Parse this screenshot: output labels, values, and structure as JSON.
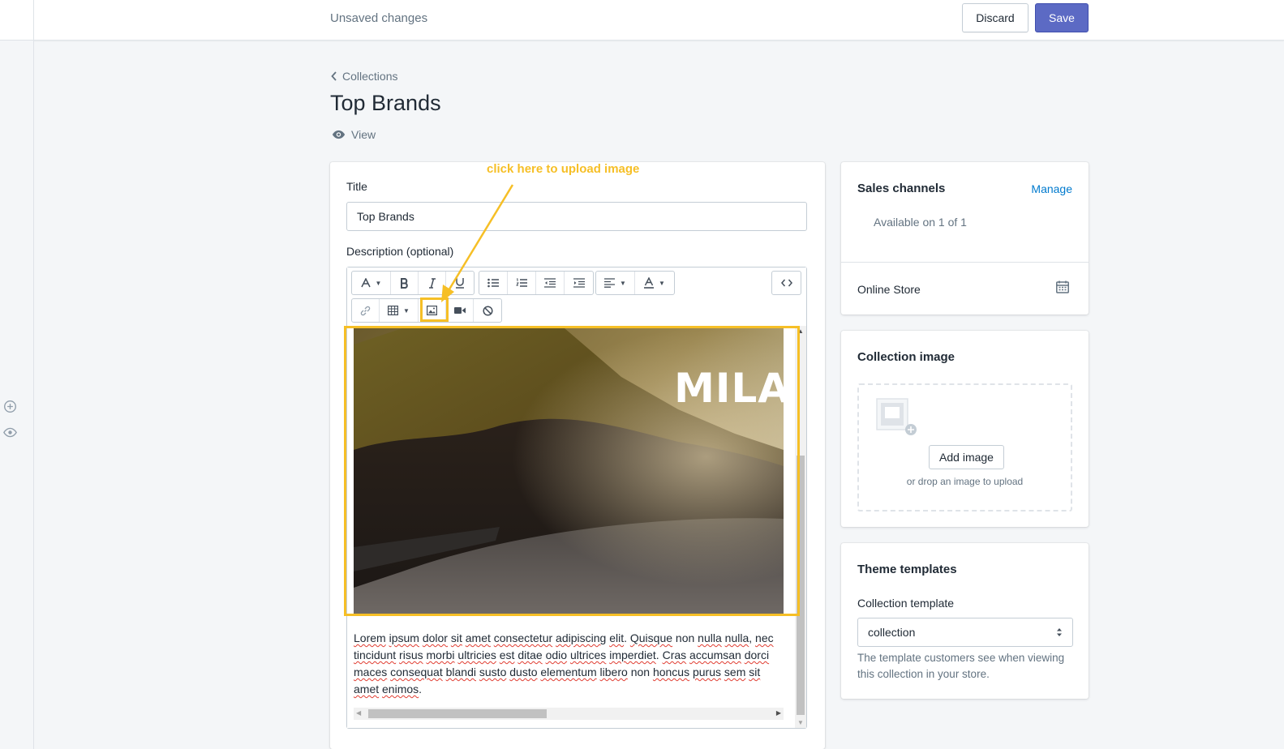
{
  "topbar": {
    "status": "Unsaved changes",
    "discard_label": "Discard",
    "save_label": "Save"
  },
  "header": {
    "breadcrumb": "Collections",
    "title": "Top Brands",
    "view_label": "View"
  },
  "form": {
    "title_label": "Title",
    "title_value": "Top Brands",
    "description_label": "Description (optional)"
  },
  "editor": {
    "image_overlay_text": "MILA",
    "paragraph_words": [
      "Lorem",
      "ipsum",
      "dolor",
      "sit",
      "amet",
      "consectetur",
      "adipiscing",
      "elit",
      "Quisque",
      "non",
      "nulla",
      "nulla",
      "nec",
      "tincidunt",
      "risus",
      "morbi",
      "ultricies",
      "est",
      "ditae",
      "odio",
      "ultrices",
      "imperdiet",
      "Cras",
      "accumsan",
      "dorci",
      "maces",
      "consequat",
      "blandi",
      "susto",
      "dusto",
      "elementum",
      "libero",
      "non",
      "honcus",
      "purus",
      "sem",
      "sit",
      "amet",
      "enimos"
    ]
  },
  "annotation": {
    "text": "click here to upload image",
    "color": "#f6bf26"
  },
  "sales_channels": {
    "title": "Sales channels",
    "manage_label": "Manage",
    "availability": "Available on 1 of 1",
    "channel": "Online Store"
  },
  "collection_image": {
    "title": "Collection image",
    "add_label": "Add image",
    "drop_hint": "or drop an image to upload"
  },
  "theme_templates": {
    "title": "Theme templates",
    "template_label": "Collection template",
    "template_value": "collection",
    "help_text": "The template customers see when viewing this collection in your store."
  },
  "colors": {
    "primary": "#5c6ac4",
    "link": "#007ace",
    "annotation": "#f6bf26"
  }
}
